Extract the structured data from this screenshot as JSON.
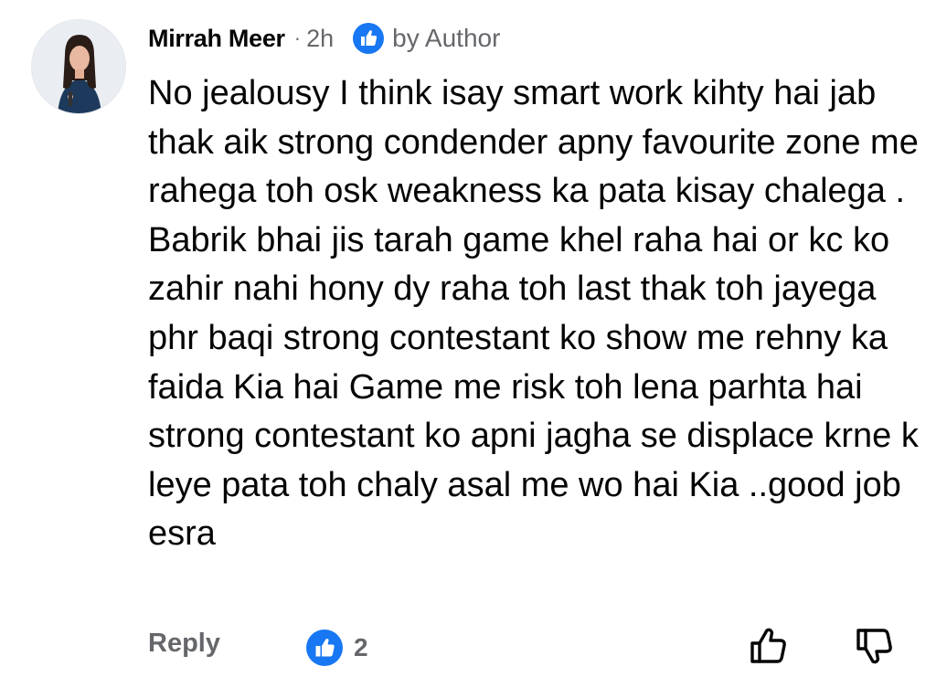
{
  "comment": {
    "author": "Mirrah Meer",
    "separator": "·",
    "time": "2h",
    "badge_label": "by Author",
    "text": "No jealousy I think isay smart work kihty hai jab thak aik strong condender apny favourite zone me rahega toh osk weakness ka pata kisay chalega . Babrik bhai jis tarah game khel raha hai or kc ko zahir nahi hony dy raha toh last thak toh jayega phr baqi strong contestant ko show me rehny ka faida Kia hai Game me risk toh lena parhta hai strong contestant ko apni jagha se displace krne k leye pata toh chaly asal me wo hai Kia ..good job esra",
    "reply_label": "Reply",
    "reaction": {
      "icon": "like-reaction-icon",
      "count": "2"
    },
    "actions": {
      "like_icon": "thumbs-up-outline-icon",
      "dislike_icon": "thumbs-down-outline-icon"
    }
  },
  "colors": {
    "text_primary": "#050505",
    "text_secondary": "#65676b",
    "brand_blue": "#1877f2",
    "background": "#ffffff"
  }
}
